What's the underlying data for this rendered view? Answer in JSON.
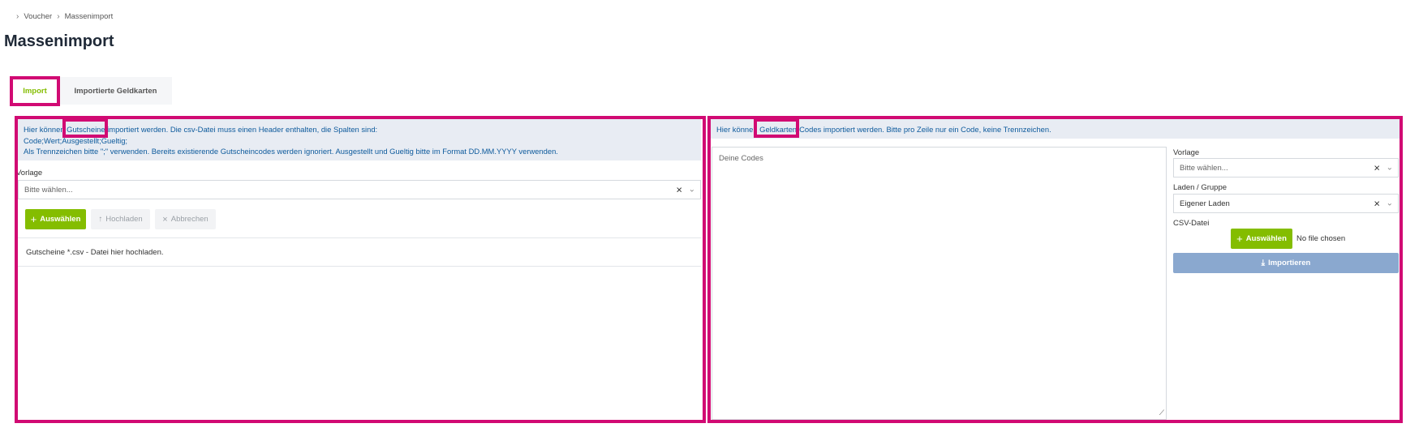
{
  "breadcrumb": {
    "items": [
      "Voucher",
      "Massenimport"
    ]
  },
  "page_title": "Massenimport",
  "tabs": [
    {
      "label": "Import",
      "active": true
    },
    {
      "label": "Importierte Geldkarten",
      "active": false
    }
  ],
  "left_panel": {
    "info_lines": [
      "Hier können Gutscheine importiert werden. Die csv-Datei muss einen Header enthalten, die Spalten sind:",
      "Code;Wert;Ausgestellt;Gueltig;",
      "Als Trennzeichen bitte \";\" verwenden. Bereits existierende Gutscheincodes werden ignoriert. Ausgestellt und Gueltig bitte im Format DD.MM.YYYY verwenden."
    ],
    "template_label": "Vorlage",
    "template_placeholder": "Bitte wählen...",
    "buttons": {
      "select": "Auswählen",
      "upload": "Hochladen",
      "cancel": "Abbrechen"
    },
    "dropzone_text": "Gutscheine *.csv - Datei hier hochladen."
  },
  "right_panel": {
    "info": "Hier können Geldkarten-Codes importiert werden. Bitte pro Zeile nur ein Code, keine Trennzeichen.",
    "codes_placeholder": "Deine Codes",
    "template_label": "Vorlage",
    "template_placeholder": "Bitte wählen...",
    "store_label": "Laden / Gruppe",
    "store_value": "Eigener Laden",
    "csv_label": "CSV-Datei",
    "select_button": "Auswählen",
    "no_file": "No file chosen",
    "import_button": "Importieren"
  },
  "colors": {
    "accent_green": "#84bd00",
    "highlight": "#d10a73",
    "info_text": "#0d5a9c",
    "info_bg": "#e8ecf3",
    "import_button": "#8aa8cf"
  }
}
